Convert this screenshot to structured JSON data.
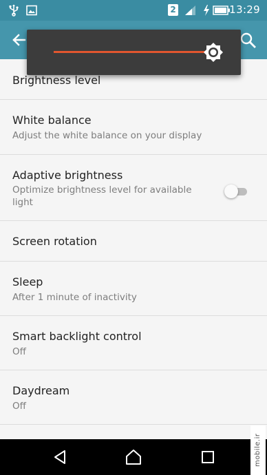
{
  "status_bar": {
    "time": "13:29",
    "sim_badge": "2",
    "icons": [
      "usb-icon",
      "image-notification-icon",
      "sim-badge",
      "signal-icon",
      "charging-bolt-icon",
      "battery-icon"
    ]
  },
  "app_bar": {
    "back_icon": "arrow-back-icon",
    "search_icon": "search-icon",
    "color": "#4596ac"
  },
  "brightness_popup": {
    "level": 1.0,
    "accent_color": "#e2562f",
    "thumb_icon": "brightness-icon"
  },
  "settings": {
    "items": [
      {
        "title": "Brightness level"
      },
      {
        "title": "White balance",
        "subtitle": "Adjust the white balance on your display"
      },
      {
        "title": "Adaptive brightness",
        "subtitle_line1": "Optimize brightness level for available",
        "subtitle_line2": "light",
        "toggle_on": false
      },
      {
        "title": "Screen rotation"
      },
      {
        "title": "Sleep",
        "subtitle": "After 1 minute of inactivity"
      },
      {
        "title": "Smart backlight control",
        "subtitle": "Off"
      },
      {
        "title": "Daydream",
        "subtitle": "Off"
      }
    ]
  },
  "nav_bar": {
    "icons": [
      "back-triangle-icon",
      "home-icon",
      "recents-icon"
    ]
  },
  "watermark": "mobile.ir"
}
